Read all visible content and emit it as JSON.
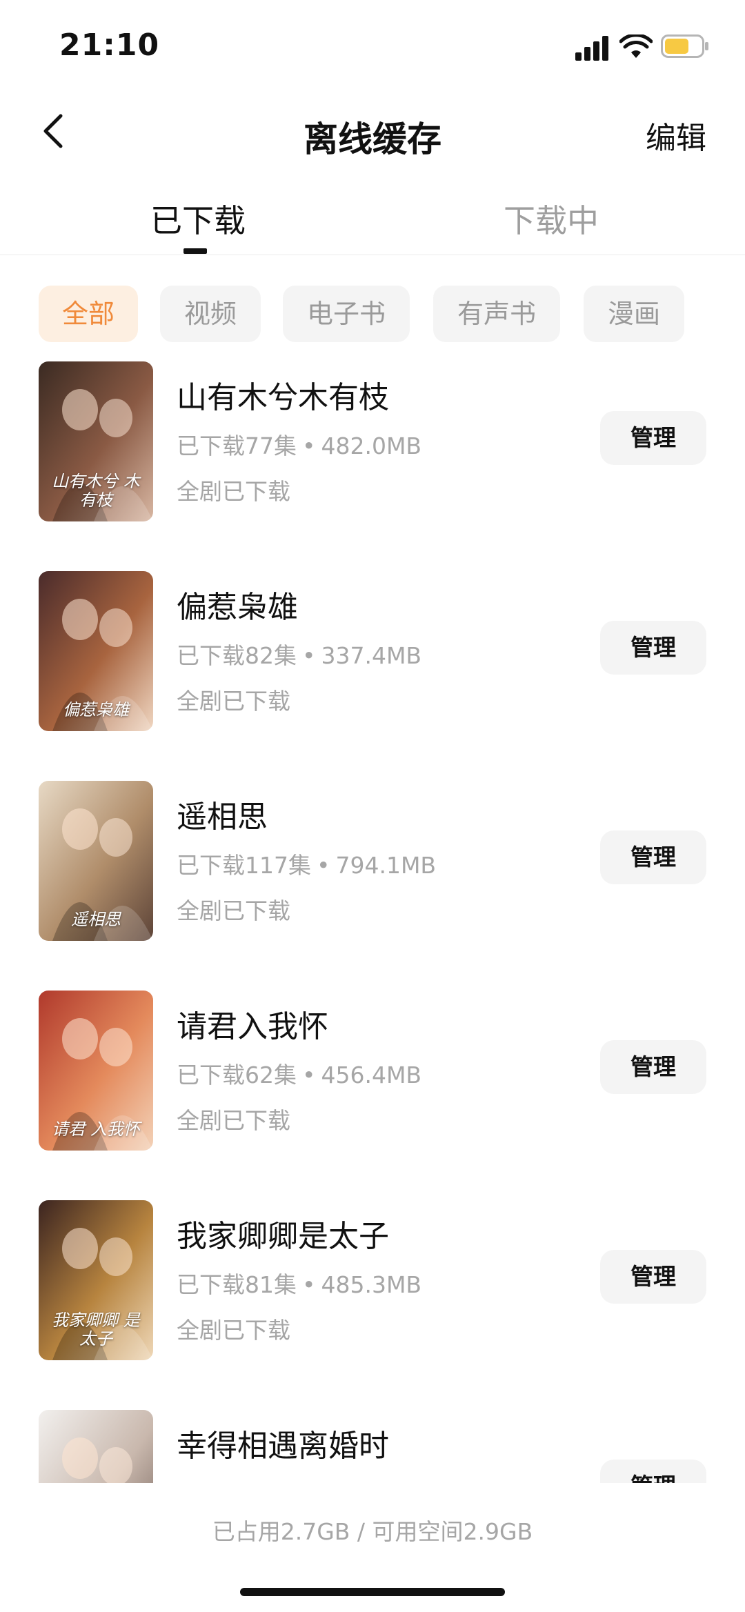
{
  "status_bar": {
    "time": "21:10"
  },
  "nav": {
    "title": "离线缓存",
    "edit_label": "编辑"
  },
  "tabs": [
    {
      "label": "已下载",
      "active": true
    },
    {
      "label": "下载中",
      "active": false
    }
  ],
  "filters": [
    {
      "label": "全部",
      "active": true
    },
    {
      "label": "视频",
      "active": false
    },
    {
      "label": "电子书",
      "active": false
    },
    {
      "label": "有声书",
      "active": false
    },
    {
      "label": "漫画",
      "active": false
    }
  ],
  "items": [
    {
      "title": "山有木兮木有枝",
      "episodes": "已下载77集",
      "size": "482.0MB",
      "status": "全剧已下载",
      "manage_label": "管理",
      "cover_colors": [
        "#3a2a22",
        "#8a5a44",
        "#d8b7a3"
      ],
      "cover_text": "山有木兮 木有枝"
    },
    {
      "title": "偏惹枭雄",
      "episodes": "已下载82集",
      "size": "337.4MB",
      "status": "全剧已下载",
      "manage_label": "管理",
      "cover_colors": [
        "#4a2b2b",
        "#a8643f",
        "#f0d7c2"
      ],
      "cover_text": "偏惹枭雄"
    },
    {
      "title": "遥相思",
      "episodes": "已下载117集",
      "size": "794.1MB",
      "status": "全剧已下载",
      "manage_label": "管理",
      "cover_colors": [
        "#e7d9c5",
        "#b08d6a",
        "#5d4438"
      ],
      "cover_text": "遥相思"
    },
    {
      "title": "请君入我怀",
      "episodes": "已下载62集",
      "size": "456.4MB",
      "status": "全剧已下载",
      "manage_label": "管理",
      "cover_colors": [
        "#b0392c",
        "#e48a5c",
        "#f3d2b8"
      ],
      "cover_text": "请君 入我怀"
    },
    {
      "title": "我家卿卿是太子",
      "episodes": "已下载81集",
      "size": "485.3MB",
      "status": "全剧已下载",
      "manage_label": "管理",
      "cover_colors": [
        "#3b2420",
        "#b7843f",
        "#efd8b8"
      ],
      "cover_text": "我家卿卿 是太子"
    },
    {
      "title": "幸得相遇离婚时",
      "episodes": "",
      "size": "",
      "status": "",
      "manage_label": "管理",
      "cover_colors": [
        "#f2f0ee",
        "#c9b8ad",
        "#6d5b54"
      ],
      "cover_text": ""
    }
  ],
  "footer": {
    "storage": "已占用2.7GB / 可用空间2.9GB"
  },
  "colors": {
    "accent": "#f08a3a",
    "accent_bg": "#fdefe1",
    "chip_bg": "#f4f4f4",
    "muted_text": "#a6a6a6"
  }
}
